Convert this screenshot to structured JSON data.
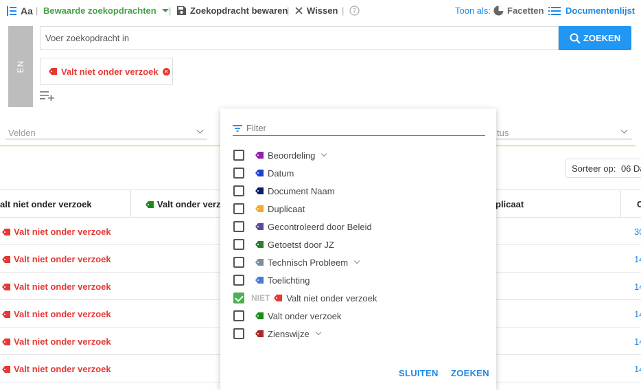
{
  "toolbar": {
    "aa_label": "Aa",
    "saved_searches": "Bewaarde zoekopdrachten",
    "save_search": "Zoekopdracht bewaren",
    "clear": "Wissen",
    "separator": "|",
    "show_as": "Toon als:",
    "facets": "Facetten",
    "document_list": "Documentenlijst"
  },
  "search": {
    "lang": "EN",
    "placeholder": "Voer zoekopdracht in",
    "button": "ZOEKEN"
  },
  "chip": {
    "label": "Valt niet onder verzoek"
  },
  "fields": {
    "left_label": "Velden",
    "right_label_partial": "tus"
  },
  "sort": {
    "label": "Sorteer op:",
    "value": "06 Da"
  },
  "table": {
    "headers": [
      "alt niet onder verzoek",
      "Valt onder verzo",
      "plicaat",
      "C"
    ],
    "rows": [
      {
        "label": "Valt niet onder verzoek",
        "num": "30"
      },
      {
        "label": "Valt niet onder verzoek",
        "num": "14"
      },
      {
        "label": "Valt niet onder verzoek",
        "num": "14"
      },
      {
        "label": "Valt niet onder verzoek",
        "num": "14"
      },
      {
        "label": "Valt niet onder verzoek",
        "num": "14"
      },
      {
        "label": "Valt niet onder verzoek",
        "num": "14"
      }
    ]
  },
  "panel": {
    "filter_placeholder": "Filter",
    "niet": "NIET",
    "options": [
      {
        "label": "Beoordeling",
        "color": "#8e24aa",
        "chevron": true
      },
      {
        "label": "Datum",
        "color": "#1e3fd6",
        "chevron": false
      },
      {
        "label": "Document Naam",
        "color": "#0d1b6b",
        "chevron": false
      },
      {
        "label": "Duplicaat",
        "color": "#f9a825",
        "chevron": false
      },
      {
        "label": "Gecontroleerd door Beleid",
        "color": "#5c4b9b",
        "chevron": false
      },
      {
        "label": "Getoetst door JZ",
        "color": "#2e7d32",
        "chevron": false
      },
      {
        "label": "Technisch Probleem",
        "color": "#78909c",
        "chevron": true
      },
      {
        "label": "Toelichting",
        "color": "#4a78d8",
        "chevron": false
      },
      {
        "label": "Valt niet onder verzoek",
        "color": "#e53935",
        "chevron": false,
        "checked": true
      },
      {
        "label": "Valt onder verzoek",
        "color": "#1b8a1b",
        "chevron": false
      },
      {
        "label": "Zienswijze",
        "color": "#a52a2a",
        "chevron": true
      }
    ],
    "close": "SLUITEN",
    "search": "ZOEKEN"
  },
  "colors": {
    "accent": "#2196f3",
    "green": "#43a047",
    "red": "#e53935",
    "divider": "#f0b400"
  }
}
